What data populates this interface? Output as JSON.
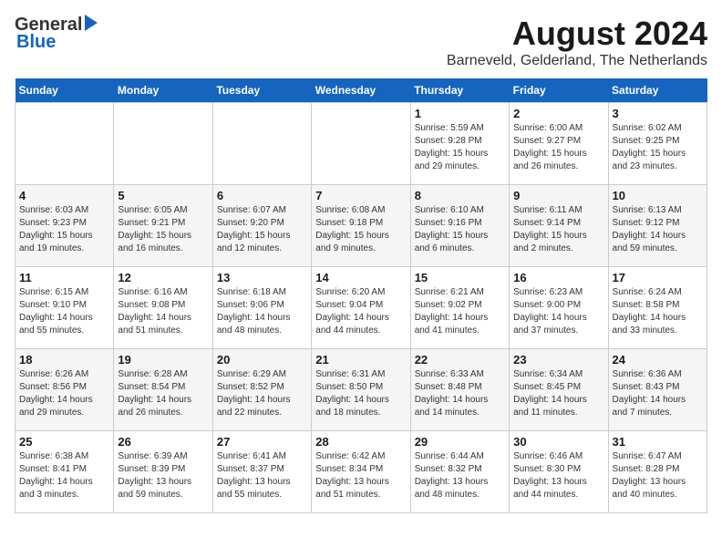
{
  "header": {
    "logo_general": "General",
    "logo_blue": "Blue",
    "title": "August 2024",
    "subtitle": "Barneveld, Gelderland, The Netherlands"
  },
  "weekdays": [
    "Sunday",
    "Monday",
    "Tuesday",
    "Wednesday",
    "Thursday",
    "Friday",
    "Saturday"
  ],
  "weeks": [
    [
      {
        "day": "",
        "info": ""
      },
      {
        "day": "",
        "info": ""
      },
      {
        "day": "",
        "info": ""
      },
      {
        "day": "",
        "info": ""
      },
      {
        "day": "1",
        "info": "Sunrise: 5:59 AM\nSunset: 9:28 PM\nDaylight: 15 hours\nand 29 minutes."
      },
      {
        "day": "2",
        "info": "Sunrise: 6:00 AM\nSunset: 9:27 PM\nDaylight: 15 hours\nand 26 minutes."
      },
      {
        "day": "3",
        "info": "Sunrise: 6:02 AM\nSunset: 9:25 PM\nDaylight: 15 hours\nand 23 minutes."
      }
    ],
    [
      {
        "day": "4",
        "info": "Sunrise: 6:03 AM\nSunset: 9:23 PM\nDaylight: 15 hours\nand 19 minutes."
      },
      {
        "day": "5",
        "info": "Sunrise: 6:05 AM\nSunset: 9:21 PM\nDaylight: 15 hours\nand 16 minutes."
      },
      {
        "day": "6",
        "info": "Sunrise: 6:07 AM\nSunset: 9:20 PM\nDaylight: 15 hours\nand 12 minutes."
      },
      {
        "day": "7",
        "info": "Sunrise: 6:08 AM\nSunset: 9:18 PM\nDaylight: 15 hours\nand 9 minutes."
      },
      {
        "day": "8",
        "info": "Sunrise: 6:10 AM\nSunset: 9:16 PM\nDaylight: 15 hours\nand 6 minutes."
      },
      {
        "day": "9",
        "info": "Sunrise: 6:11 AM\nSunset: 9:14 PM\nDaylight: 15 hours\nand 2 minutes."
      },
      {
        "day": "10",
        "info": "Sunrise: 6:13 AM\nSunset: 9:12 PM\nDaylight: 14 hours\nand 59 minutes."
      }
    ],
    [
      {
        "day": "11",
        "info": "Sunrise: 6:15 AM\nSunset: 9:10 PM\nDaylight: 14 hours\nand 55 minutes."
      },
      {
        "day": "12",
        "info": "Sunrise: 6:16 AM\nSunset: 9:08 PM\nDaylight: 14 hours\nand 51 minutes."
      },
      {
        "day": "13",
        "info": "Sunrise: 6:18 AM\nSunset: 9:06 PM\nDaylight: 14 hours\nand 48 minutes."
      },
      {
        "day": "14",
        "info": "Sunrise: 6:20 AM\nSunset: 9:04 PM\nDaylight: 14 hours\nand 44 minutes."
      },
      {
        "day": "15",
        "info": "Sunrise: 6:21 AM\nSunset: 9:02 PM\nDaylight: 14 hours\nand 41 minutes."
      },
      {
        "day": "16",
        "info": "Sunrise: 6:23 AM\nSunset: 9:00 PM\nDaylight: 14 hours\nand 37 minutes."
      },
      {
        "day": "17",
        "info": "Sunrise: 6:24 AM\nSunset: 8:58 PM\nDaylight: 14 hours\nand 33 minutes."
      }
    ],
    [
      {
        "day": "18",
        "info": "Sunrise: 6:26 AM\nSunset: 8:56 PM\nDaylight: 14 hours\nand 29 minutes."
      },
      {
        "day": "19",
        "info": "Sunrise: 6:28 AM\nSunset: 8:54 PM\nDaylight: 14 hours\nand 26 minutes."
      },
      {
        "day": "20",
        "info": "Sunrise: 6:29 AM\nSunset: 8:52 PM\nDaylight: 14 hours\nand 22 minutes."
      },
      {
        "day": "21",
        "info": "Sunrise: 6:31 AM\nSunset: 8:50 PM\nDaylight: 14 hours\nand 18 minutes."
      },
      {
        "day": "22",
        "info": "Sunrise: 6:33 AM\nSunset: 8:48 PM\nDaylight: 14 hours\nand 14 minutes."
      },
      {
        "day": "23",
        "info": "Sunrise: 6:34 AM\nSunset: 8:45 PM\nDaylight: 14 hours\nand 11 minutes."
      },
      {
        "day": "24",
        "info": "Sunrise: 6:36 AM\nSunset: 8:43 PM\nDaylight: 14 hours\nand 7 minutes."
      }
    ],
    [
      {
        "day": "25",
        "info": "Sunrise: 6:38 AM\nSunset: 8:41 PM\nDaylight: 14 hours\nand 3 minutes."
      },
      {
        "day": "26",
        "info": "Sunrise: 6:39 AM\nSunset: 8:39 PM\nDaylight: 13 hours\nand 59 minutes."
      },
      {
        "day": "27",
        "info": "Sunrise: 6:41 AM\nSunset: 8:37 PM\nDaylight: 13 hours\nand 55 minutes."
      },
      {
        "day": "28",
        "info": "Sunrise: 6:42 AM\nSunset: 8:34 PM\nDaylight: 13 hours\nand 51 minutes."
      },
      {
        "day": "29",
        "info": "Sunrise: 6:44 AM\nSunset: 8:32 PM\nDaylight: 13 hours\nand 48 minutes."
      },
      {
        "day": "30",
        "info": "Sunrise: 6:46 AM\nSunset: 8:30 PM\nDaylight: 13 hours\nand 44 minutes."
      },
      {
        "day": "31",
        "info": "Sunrise: 6:47 AM\nSunset: 8:28 PM\nDaylight: 13 hours\nand 40 minutes."
      }
    ]
  ]
}
